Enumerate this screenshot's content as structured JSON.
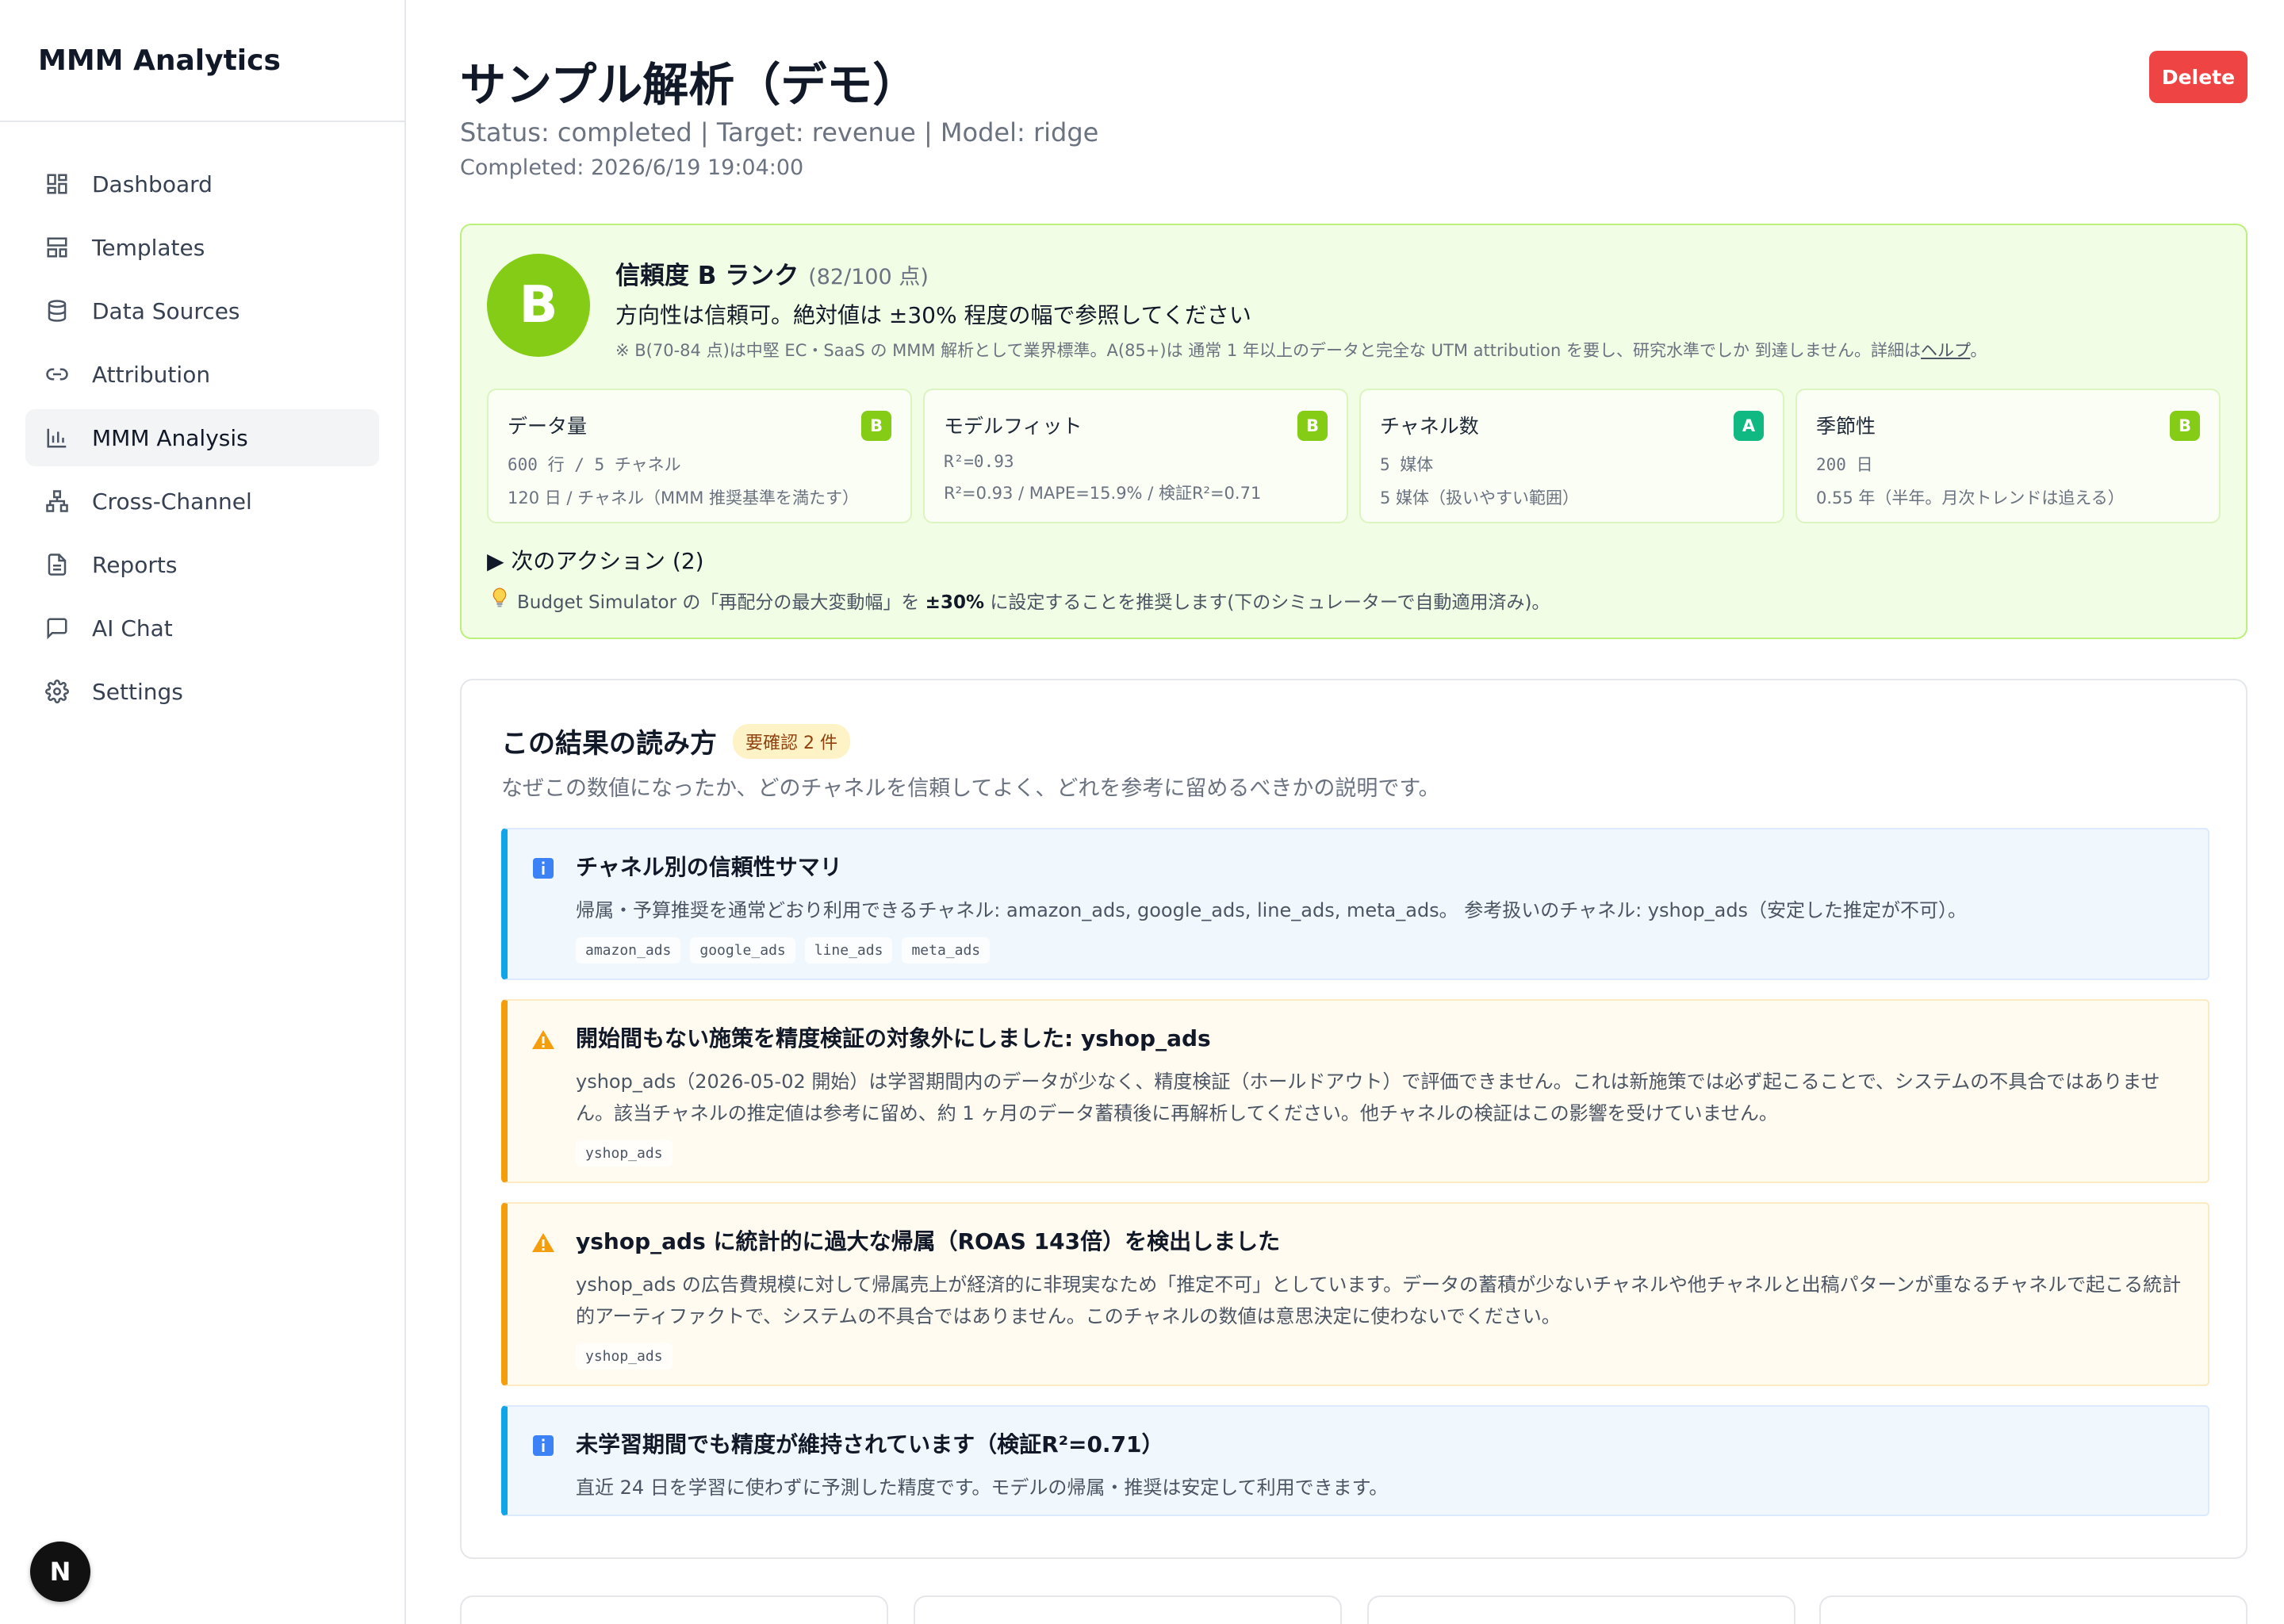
{
  "brand": "MMM Analytics",
  "nav": [
    {
      "label": "Dashboard",
      "icon": "dashboard-icon",
      "active": false
    },
    {
      "label": "Templates",
      "icon": "templates-icon",
      "active": false
    },
    {
      "label": "Data Sources",
      "icon": "database-icon",
      "active": false
    },
    {
      "label": "Attribution",
      "icon": "link-icon",
      "active": false
    },
    {
      "label": "MMM Analysis",
      "icon": "bar-chart-icon",
      "active": true
    },
    {
      "label": "Cross-Channel",
      "icon": "network-icon",
      "active": false
    },
    {
      "label": "Reports",
      "icon": "report-icon",
      "active": false
    },
    {
      "label": "AI Chat",
      "icon": "chat-icon",
      "active": false
    },
    {
      "label": "Settings",
      "icon": "gear-icon",
      "active": false
    }
  ],
  "next_badge": "N",
  "header": {
    "title": "サンプル解析（デモ）",
    "meta": "Status: completed | Target: revenue | Model: ridge",
    "completed": "Completed: 2026/6/19 19:04:00",
    "delete_label": "Delete"
  },
  "confidence": {
    "grade": "B",
    "title": "信頼度 B ランク",
    "score": "(82/100 点)",
    "subtitle": "方向性は信頼可。絶対値は ±30% 程度の幅で参照してください",
    "note": "※ B(70-84 点)は中堅 EC・SaaS の MMM 解析として業界標準。A(85+)は 通常 1 年以上のデータと完全な UTM attribution を要し、研究水準でしか 到達しません。詳細は",
    "help_link": "ヘルプ",
    "note_end": "。",
    "metrics": [
      {
        "title": "データ量",
        "grade": "B",
        "value": "600 行 / 5 チャネル",
        "desc": "120 日 / チャネル（MMM 推奨基準を満たす）"
      },
      {
        "title": "モデルフィット",
        "grade": "B",
        "value": "R²=0.93",
        "desc": "R²=0.93 / MAPE=15.9% / 検証R²=0.71"
      },
      {
        "title": "チャネル数",
        "grade": "A",
        "value": "5 媒体",
        "desc": "5 媒体（扱いやすい範囲）"
      },
      {
        "title": "季節性",
        "grade": "B",
        "value": "200 日",
        "desc": "0.55 年（半年。月次トレンドは追える）"
      }
    ],
    "next_actions": "▶ 次のアクション (2)",
    "tip_pre": "Budget Simulator の「再配分の最大変動幅」を",
    "tip_bold": "±30%",
    "tip_post": "に設定することを推奨します(下のシミュレーターで自動適用済み)。"
  },
  "reading": {
    "title": "この結果の読み方",
    "pill": "要確認 2 件",
    "subtitle": "なぜこの数値になったか、どのチャネルを信頼してよく、どれを参考に留めるべきかの説明です。",
    "alerts": [
      {
        "type": "info",
        "heading": "チャネル別の信頼性サマリ",
        "body": "帰属・予算推奨を通常どおり利用できるチャネル: amazon_ads, google_ads, line_ads, meta_ads。 参考扱いのチャネル: yshop_ads（安定した推定が不可）。",
        "tags": [
          "amazon_ads",
          "google_ads",
          "line_ads",
          "meta_ads"
        ]
      },
      {
        "type": "warn",
        "heading": "開始間もない施策を精度検証の対象外にしました: yshop_ads",
        "body": "yshop_ads（2026-05-02 開始）は学習期間内のデータが少なく、精度検証（ホールドアウト）で評価できません。これは新施策では必ず起こることで、システムの不具合ではありません。該当チャネルの推定値は参考に留め、約 1 ヶ月のデータ蓄積後に再解析してください。他チャネルの検証はこの影響を受けていません。",
        "tags": [
          "yshop_ads"
        ]
      },
      {
        "type": "warn",
        "heading": "yshop_ads に統計的に過大な帰属（ROAS 143倍）を検出しました",
        "body": "yshop_ads の広告費規模に対して帰属売上が経済的に非現実なため「推定不可」としています。データの蓄積が少ないチャネルや他チャネルと出稿パターンが重なるチャネルで起こる統計的アーティファクトで、システムの不具合ではありません。このチャネルの数値は意思決定に使わないでください。",
        "tags": [
          "yshop_ads"
        ]
      },
      {
        "type": "info",
        "heading": "未学習期間でも精度が維持されています（検証R²=0.71）",
        "body": "直近 24 日を学習に使わずに予測した精度です。モデルの帰属・推奨は安定して利用できます。",
        "tags": []
      }
    ]
  },
  "colors": {
    "grade_b": "#84cc16",
    "grade_a": "#10b981",
    "delete": "#ef4444",
    "info_accent": "#0ea5e9",
    "warn_accent": "#f59e0b"
  }
}
